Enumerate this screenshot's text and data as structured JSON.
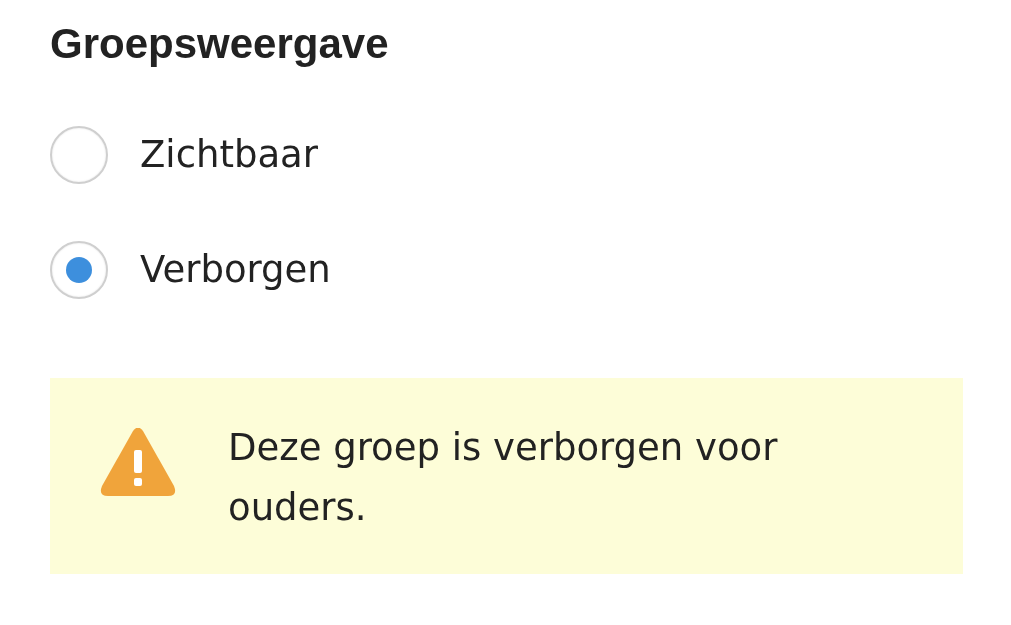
{
  "section": {
    "title": "Groepsweergave"
  },
  "options": [
    {
      "label": "Zichtbaar",
      "selected": false
    },
    {
      "label": "Verborgen",
      "selected": true
    }
  ],
  "notice": {
    "kind": "warning",
    "text": "Deze groep is verborgen voor ouders."
  }
}
